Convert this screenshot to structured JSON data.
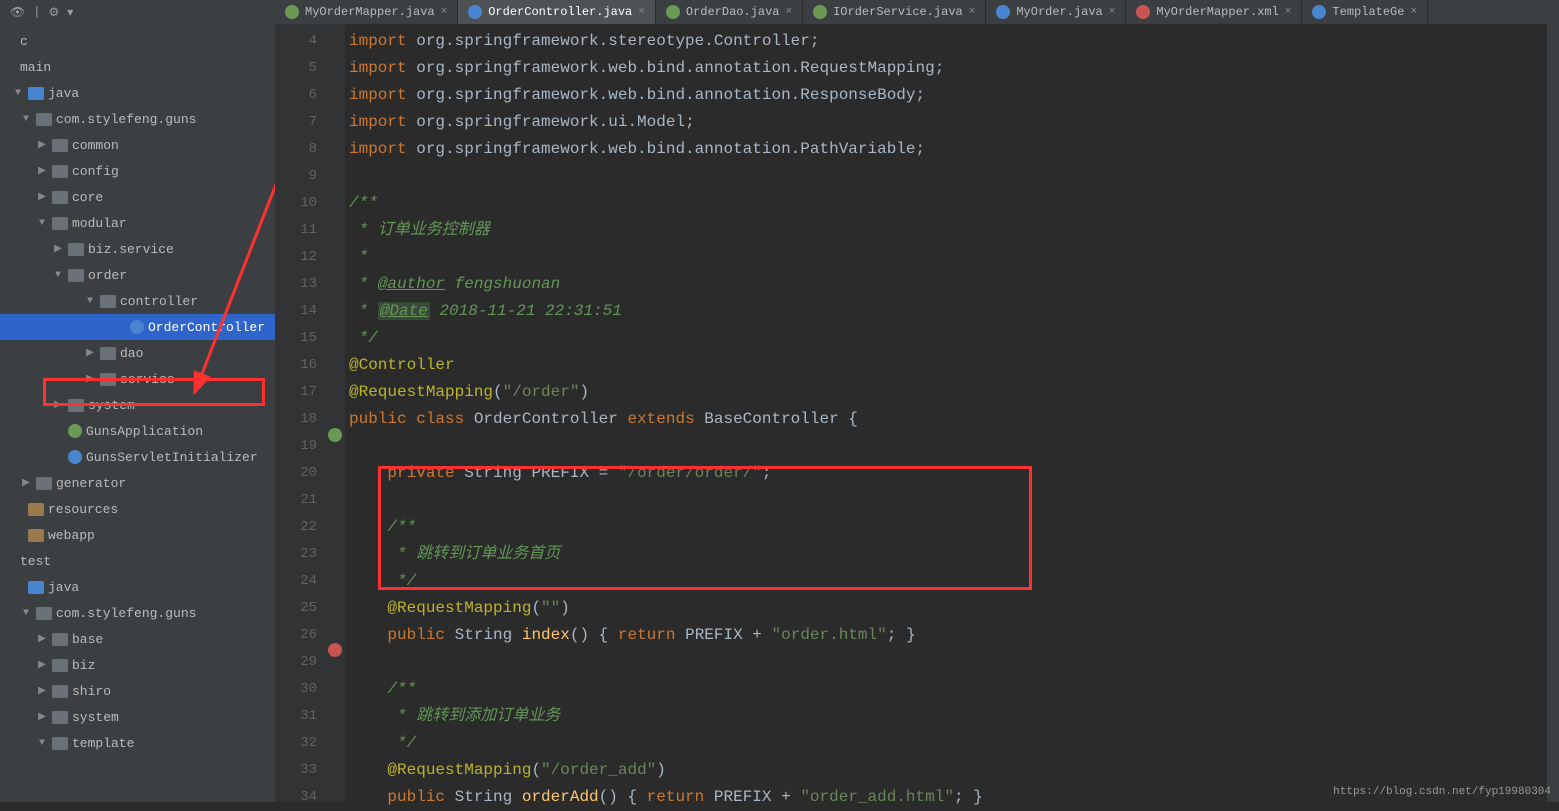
{
  "tabs": [
    {
      "label": "MyOrderMapper.java",
      "type": "i"
    },
    {
      "label": "OrderController.java",
      "type": "c",
      "active": true
    },
    {
      "label": "OrderDao.java",
      "type": "i"
    },
    {
      "label": "IOrderService.java",
      "type": "i"
    },
    {
      "label": "MyOrder.java",
      "type": "c"
    },
    {
      "label": "MyOrderMapper.xml",
      "type": "xml"
    },
    {
      "label": "TemplateGe",
      "type": "c"
    }
  ],
  "tree": [
    {
      "ind": 4,
      "arr": "",
      "label": "c"
    },
    {
      "ind": 4,
      "arr": "",
      "label": "main"
    },
    {
      "ind": 12,
      "arr": "▼",
      "fld": "blue",
      "label": "java"
    },
    {
      "ind": 20,
      "arr": "▼",
      "fld": "",
      "label": "com.stylefeng.guns"
    },
    {
      "ind": 36,
      "arr": "▶",
      "fld": "",
      "label": "common"
    },
    {
      "ind": 36,
      "arr": "▶",
      "fld": "",
      "label": "config"
    },
    {
      "ind": 36,
      "arr": "▶",
      "fld": "",
      "label": "core"
    },
    {
      "ind": 36,
      "arr": "▼",
      "fld": "",
      "label": "modular"
    },
    {
      "ind": 52,
      "arr": "▶",
      "fld": "",
      "label": "biz.service"
    },
    {
      "ind": 52,
      "arr": "▼",
      "fld": "",
      "label": "order"
    },
    {
      "ind": 84,
      "arr": "▼",
      "fld": "",
      "label": "controller"
    },
    {
      "ind": 114,
      "arr": "",
      "cls": "c",
      "label": "OrderController",
      "sel": true
    },
    {
      "ind": 84,
      "arr": "▶",
      "fld": "",
      "label": "dao"
    },
    {
      "ind": 84,
      "arr": "▶",
      "fld": "",
      "label": "service"
    },
    {
      "ind": 52,
      "arr": "▶",
      "fld": "",
      "label": "system"
    },
    {
      "ind": 52,
      "arr": "",
      "cls": "grn",
      "label": "GunsApplication"
    },
    {
      "ind": 52,
      "arr": "",
      "cls": "c",
      "label": "GunsServletInitializer"
    },
    {
      "ind": 20,
      "arr": "▶",
      "fld": "",
      "label": "generator"
    },
    {
      "ind": 12,
      "arr": "",
      "fld": "res",
      "label": "resources"
    },
    {
      "ind": 12,
      "arr": "",
      "fld": "res",
      "label": "webapp"
    },
    {
      "ind": 4,
      "arr": "",
      "label": "test"
    },
    {
      "ind": 12,
      "arr": "",
      "fld": "blue",
      "label": "java"
    },
    {
      "ind": 20,
      "arr": "▼",
      "fld": "",
      "label": "com.stylefeng.guns"
    },
    {
      "ind": 36,
      "arr": "▶",
      "fld": "",
      "label": "base"
    },
    {
      "ind": 36,
      "arr": "▶",
      "fld": "",
      "label": "biz"
    },
    {
      "ind": 36,
      "arr": "▶",
      "fld": "",
      "label": "shiro"
    },
    {
      "ind": 36,
      "arr": "▶",
      "fld": "",
      "label": "system"
    },
    {
      "ind": 36,
      "arr": "▼",
      "fld": "",
      "label": "template"
    }
  ],
  "line_numbers": [
    "4",
    "5",
    "6",
    "7",
    "8",
    "9",
    "10",
    "11",
    "12",
    "13",
    "14",
    "15",
    "16",
    "17",
    "18",
    "19",
    "20",
    "21",
    "22",
    "23",
    "24",
    "25",
    "26",
    "29",
    "30",
    "31",
    "32",
    "33",
    "34"
  ],
  "code": {
    "l4": {
      "kw": "import",
      "pkg": " org.springframework.stereotype.",
      "cls": "Controller",
      ";": ";"
    },
    "l5": {
      "kw": "import",
      "pkg": " org.springframework.web.bind.annotation.",
      "cls": "RequestMapping",
      ";": ";"
    },
    "l6": {
      "kw": "import",
      "pkg": " org.springframework.web.bind.annotation.",
      "cls": "ResponseBody",
      ";": ";"
    },
    "l7": {
      "kw": "import",
      "pkg": " org.springframework.ui.",
      "cls": "Model",
      ";": ";"
    },
    "l8": {
      "kw": "import",
      "pkg": " org.springframework.web.bind.annotation.",
      "cls": "PathVariable",
      ";": ";"
    },
    "l10": "/**",
    "l11": " * 订单业务控制器",
    "l12": " *",
    "l13_pre": " * ",
    "l13_tag": "@author",
    "l13_post": " fengshuonan",
    "l14_pre": " * ",
    "l14_tag": "@Date",
    "l14_post": " 2018-11-21 22:31:51",
    "l15": " */",
    "l16": "@Controller",
    "l17_ann": "@RequestMapping",
    "l17_paren": "(",
    "l17_str": "\"/order\"",
    "l17_close": ")",
    "l18_pub": "public ",
    "l18_cls": "class ",
    "l18_name": "OrderController ",
    "l18_ext": "extends ",
    "l18_base": "BaseController {",
    "l20_pre": "    ",
    "l20_priv": "private ",
    "l20_type": "String ",
    "l20_var": "PREFIX = ",
    "l20_str": "\"/order/order/\"",
    "l20_sc": ";",
    "l22": "    /**",
    "l23": "     * 跳转到订单业务首页",
    "l24": "     */",
    "l25_pre": "    ",
    "l25_ann": "@RequestMapping",
    "l25_paren": "(",
    "l25_str": "\"\"",
    "l25_close": ")",
    "l26_pre": "    ",
    "l26_pub": "public ",
    "l26_type": "String ",
    "l26_fn": "index",
    "l26_sig": "() { ",
    "l26_ret": "return ",
    "l26_var": "PREFIX + ",
    "l26_str": "\"order.html\"",
    "l26_end": "; }",
    "l30": "    /**",
    "l31": "     * 跳转到添加订单业务",
    "l32": "     */",
    "l33_pre": "    ",
    "l33_ann": "@RequestMapping",
    "l33_paren": "(",
    "l33_str": "\"/order_add\"",
    "l33_close": ")",
    "l34_pre": "    ",
    "l34_pub": "public ",
    "l34_type": "String ",
    "l34_fn": "orderAdd",
    "l34_sig": "() { ",
    "l34_ret": "return ",
    "l34_var": "PREFIX + ",
    "l34_str": "\"order_add.html\"",
    "l34_end": "; }"
  },
  "watermark": "https://blog.csdn.net/fyp19980304"
}
